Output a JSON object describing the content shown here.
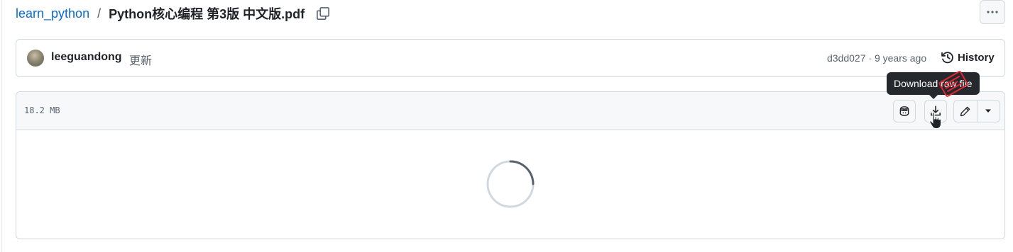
{
  "breadcrumb": {
    "repo": "learn_python",
    "separator": "/",
    "file": "Python核心编程 第3版 中文版.pdf",
    "copy_icon": "copy-icon",
    "more_icon": "kebab-horizontal-icon"
  },
  "commit": {
    "author": "leeguandong",
    "message": "更新",
    "meta": "d3dd027 · 9 years ago",
    "history_label": "History",
    "history_icon": "history-icon"
  },
  "file": {
    "size": "18.2 MB",
    "tooltip": "Download raw file",
    "buttons": [
      "copilot-icon",
      "download-icon",
      "pencil-icon",
      "triangle-down-icon"
    ]
  },
  "colors": {
    "link": "#0969da",
    "border": "#d1d9e0",
    "header_bg": "#f6f8fa",
    "tooltip_bg": "#25292e",
    "stamp": "#e3262f"
  }
}
